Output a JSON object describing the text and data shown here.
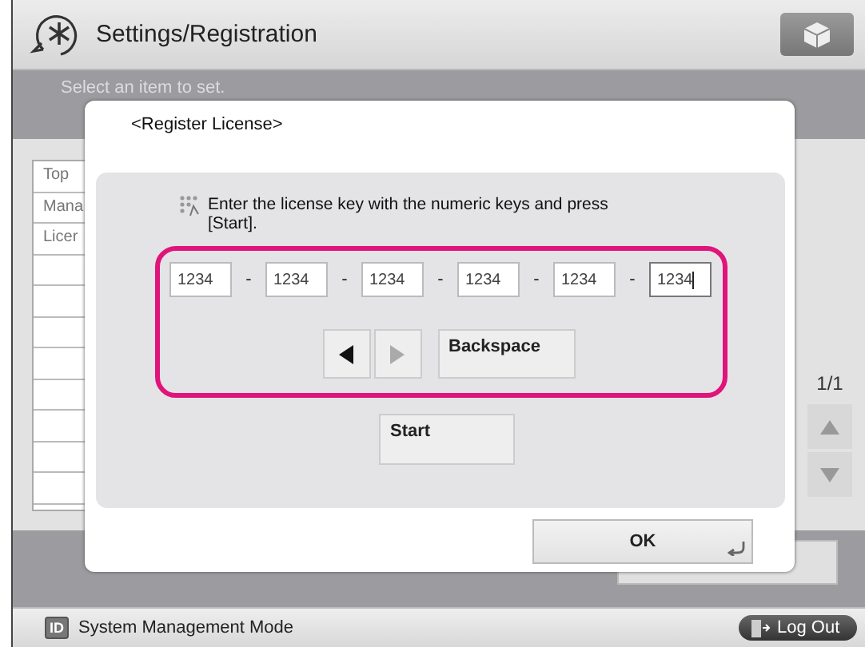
{
  "header": {
    "title": "Settings/Registration"
  },
  "page": {
    "instruction": "Select an item to set.",
    "list_items": [
      "Top",
      "Mana",
      "Licer"
    ],
    "page_counter": "1/1"
  },
  "dialog": {
    "title": "<Register License>",
    "instruction": "Enter the license key with the numeric keys and press [Start].",
    "key_fields": [
      {
        "value": "1234",
        "separator": "-",
        "focused": false
      },
      {
        "value": "1234",
        "separator": "-",
        "focused": false
      },
      {
        "value": "1234",
        "separator": "-",
        "focused": false
      },
      {
        "value": "1234",
        "separator": "-",
        "focused": false
      },
      {
        "value": "1234",
        "separator": "-",
        "focused": false
      },
      {
        "value": "1234",
        "focused": true
      }
    ],
    "cursor_left": {
      "disabled": false
    },
    "cursor_right": {
      "disabled": true
    },
    "backspace_button": "Backspace",
    "start_button": "Start",
    "ok_button": "OK"
  },
  "footer": {
    "mode_badge": "ID",
    "mode": "System Management Mode",
    "logout_button": "Log Out"
  }
}
